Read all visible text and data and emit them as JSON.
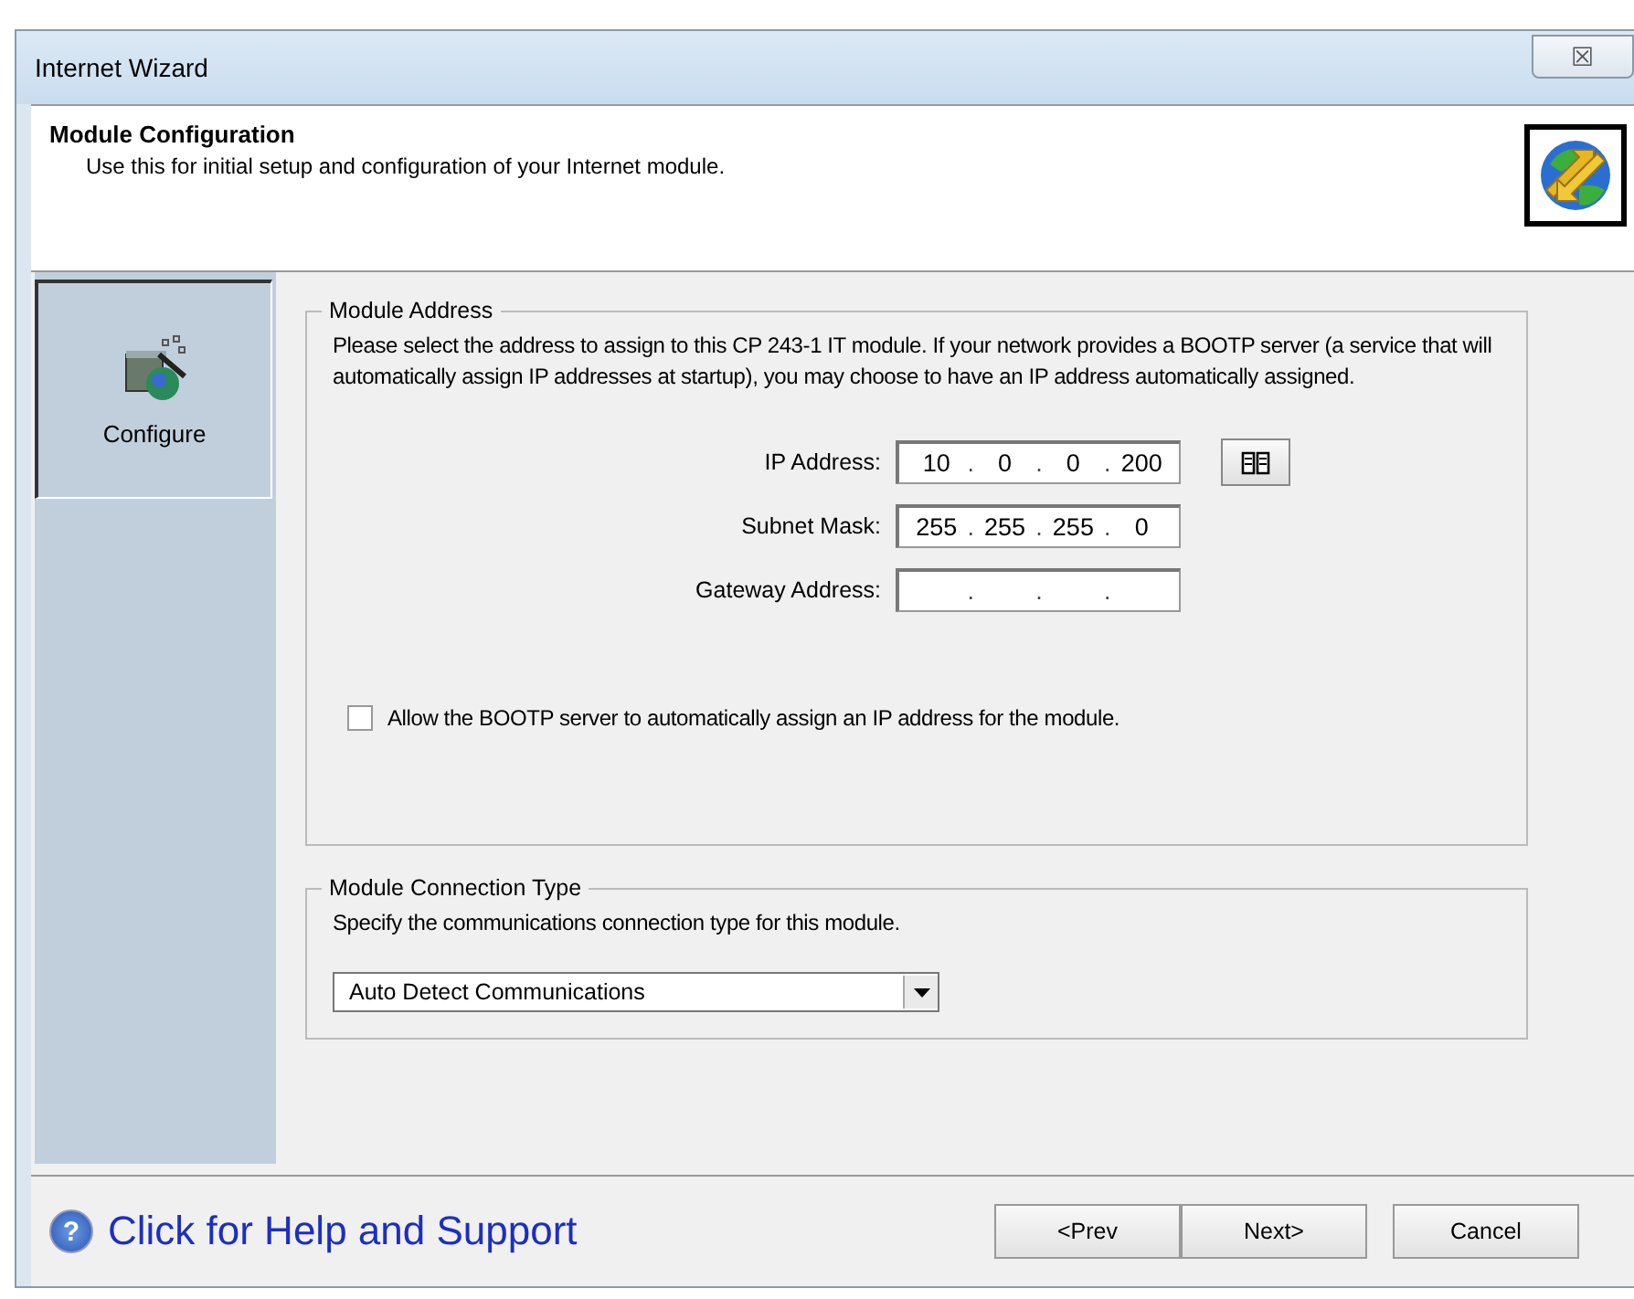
{
  "window": {
    "title": "Internet Wizard",
    "close_glyph": "☒"
  },
  "header": {
    "title": "Module Configuration",
    "subtitle": "Use this for initial setup and configuration of your Internet module."
  },
  "sidebar": {
    "items": [
      {
        "label": "Configure",
        "selected": true
      }
    ]
  },
  "module_address": {
    "legend": "Module Address",
    "description": "Please select the address to assign to this CP 243-1 IT module. If your network provides a BOOTP server (a service that will automatically assign IP addresses at startup), you may choose to have an IP address automatically assigned.",
    "fields": [
      {
        "label": "IP Address:",
        "separator": ".",
        "octets": [
          "10",
          "0",
          "0",
          "200"
        ],
        "book_button": true
      },
      {
        "label": "Subnet Mask:",
        "separator": ".",
        "octets": [
          "255",
          "255",
          "255",
          "0"
        ],
        "book_button": false
      },
      {
        "label": "Gateway Address:",
        "separator": ".",
        "book_button": false
      }
    ],
    "bootp": {
      "label": "Allow the BOOTP server to automatically assign an IP address for the module.",
      "checked": false
    }
  },
  "connection_type": {
    "legend": "Module Connection Type",
    "description": "Specify the communications connection type for this module.",
    "value": "Auto Detect Communications"
  },
  "footer": {
    "help_glyph": "?",
    "help_link": "Click for Help and Support",
    "buttons": [
      "<Prev",
      "Next>",
      "Cancel"
    ]
  }
}
